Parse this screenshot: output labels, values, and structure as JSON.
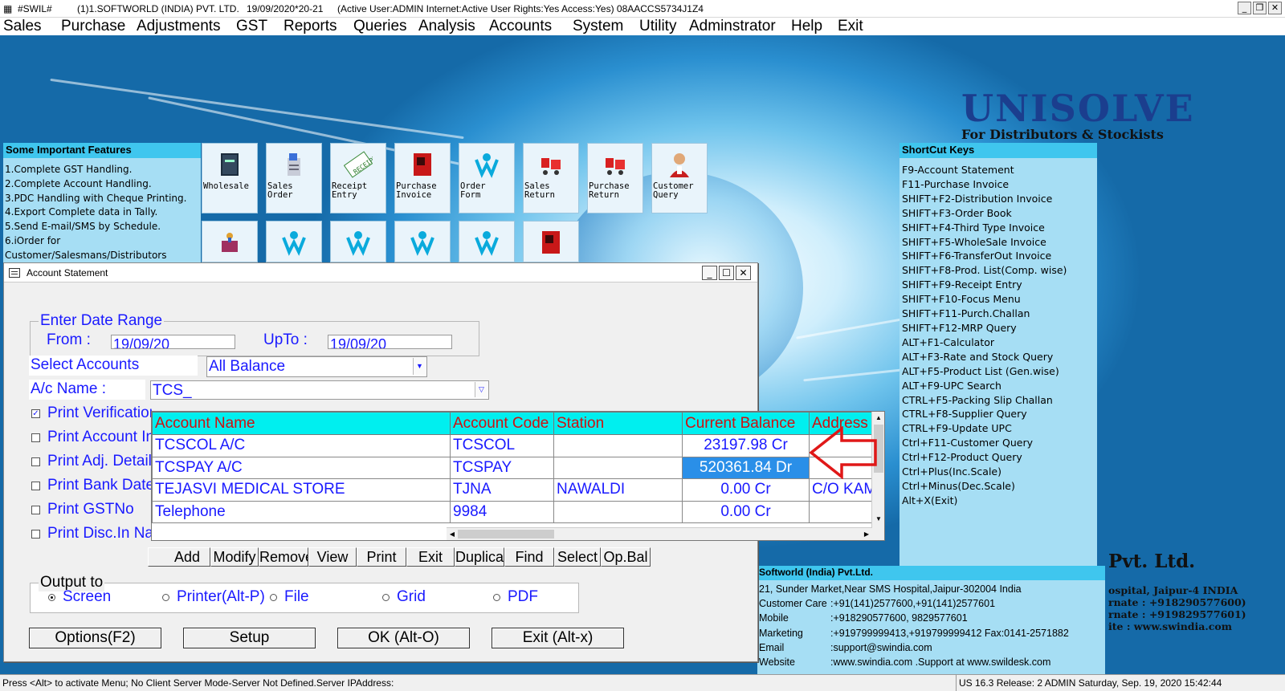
{
  "titlebar": {
    "app": "#SWIL#",
    "company": "(1)1.SOFTWORLD (INDIA) PVT. LTD.",
    "date": "19/09/2020*20-21",
    "status": "(Active User:ADMIN Internet:Active  User Rights:Yes Access:Yes) 08AACCS5734J1Z4"
  },
  "menu": [
    "Sales",
    "Purchase",
    "Adjustments",
    "GST",
    "Reports",
    "Queries",
    "Analysis",
    "Accounts",
    "System",
    "Utility",
    "Adminstrator",
    "Help",
    "Exit"
  ],
  "logo": {
    "title": "UNISOLVE",
    "subtitle": "For Distributors & Stockists"
  },
  "features": {
    "title": "Some Important Features",
    "items": [
      "1.Complete GST Handling.",
      "2.Complete Account Handling.",
      "3.PDC Handling with Cheque Printing.",
      "4.Export Complete data in Tally.",
      "5.Send E-mail/SMS by Schedule.",
      "6.iOrder for",
      "Customer/Salesmans/Distributors"
    ]
  },
  "quick_icons": [
    {
      "label": "Wholesale",
      "icon": "book-icon"
    },
    {
      "label": "Sales\nOrder",
      "icon": "order-icon"
    },
    {
      "label": "Receipt\nEntry",
      "icon": "receipt-stamp-icon"
    },
    {
      "label": "Purchase\nInvoice",
      "icon": "red-book-icon"
    },
    {
      "label": "Order\nForm",
      "icon": "swil-logo-icon"
    },
    {
      "label": "Sales\nReturn",
      "icon": "cart-icon"
    },
    {
      "label": "Purchase\nReturn",
      "icon": "cart-icon"
    },
    {
      "label": "Customer\nQuery",
      "icon": "person-icon"
    }
  ],
  "quick_icons_row2": [
    "register-icon",
    "swil-logo-icon",
    "swil-logo-icon",
    "swil-logo-icon",
    "swil-logo-icon",
    "red-book-icon"
  ],
  "shortcuts": {
    "title": "ShortCut Keys",
    "items": [
      "F9-Account Statement",
      "F11-Purchase Invoice",
      "SHIFT+F2-Distribution Invoice",
      "SHIFT+F3-Order Book",
      "SHIFT+F4-Third Type Invoice",
      "SHIFT+F5-WholeSale Invoice",
      "SHIFT+F6-TransferOut Invoice",
      "SHIFT+F8-Prod. List(Comp. wise)",
      "SHIFT+F9-Receipt Entry",
      "SHIFT+F10-Focus Menu",
      "SHIFT+F11-Purch.Challan",
      "SHIFT+F12-MRP Query",
      "ALT+F1-Calculator",
      "ALT+F3-Rate and Stock Query",
      "ALT+F5-Product List (Gen.wise)",
      "ALT+F9-UPC Search",
      "CTRL+F5-Packing Slip Challan",
      "CTRL+F8-Supplier Query",
      "CTRL+F9-Update UPC",
      "Ctrl+F11-Customer Query",
      "Ctrl+F12-Product Query",
      "Ctrl+Plus(Inc.Scale)",
      "Ctrl+Minus(Dec.Scale)",
      "Alt+X(Exit)"
    ]
  },
  "company": {
    "name": "Softworld (India) Pvt.Ltd.",
    "address": "21, Sunder Market,Near SMS Hospital,Jaipur-302004 India",
    "rows": [
      {
        "k": "Customer Care",
        "v": ":+91(141)2577600,+91(141)2577601"
      },
      {
        "k": "Mobile",
        "v": ":+918290577600, 9829577601"
      },
      {
        "k": "Marketing",
        "v": ":+919799999413,+919799999412 Fax:0141-2571882"
      },
      {
        "k": "Email",
        "v": ":support@swindia.com"
      },
      {
        "k": "Website",
        "v": ":www.swindia.com .Support at www.swildesk.com"
      }
    ],
    "pvt": "Pvt. Ltd.",
    "right_lines": [
      "ospital, Jaipur-4 INDIA",
      "rnate : +918290577600)",
      "rnate : +919829577601)",
      "ite : www.swindia.com"
    ]
  },
  "dialog": {
    "title": "Account Statement",
    "date_range_label": "Enter Date Range",
    "from_label": "From :",
    "from_value": "19/09/20",
    "upto_label": "UpTo :",
    "upto_value": "19/09/20",
    "select_accounts_label": "Select Accounts",
    "select_accounts_value": "All Balance",
    "ac_name_label": "A/c Name :",
    "ac_name_value": "TCS_",
    "checkboxes": [
      {
        "label": "Print Verification",
        "checked": true
      },
      {
        "label": "Print Account In",
        "checked": false
      },
      {
        "label": "Print Adj. Detail",
        "checked": false
      },
      {
        "label": "Print Bank Date",
        "checked": false
      },
      {
        "label": "Print GSTNo",
        "checked": false
      },
      {
        "label": "Print Disc.In Na",
        "checked": false
      }
    ],
    "grid": {
      "columns": [
        "Account Name",
        "Account Code",
        "Station",
        "Current Balance",
        "Address"
      ],
      "rows": [
        [
          "TCSCOL A/C",
          "TCSCOL",
          "",
          "23197.98 Cr",
          ""
        ],
        [
          "TCSPAY A/C",
          "TCSPAY",
          "",
          "520361.84 Dr",
          ""
        ],
        [
          "TEJASVI MEDICAL STORE",
          "TJNA",
          "NAWALDI",
          "0.00 Cr",
          "C/O KAM"
        ],
        [
          "Telephone",
          "9984",
          "",
          "0.00 Cr",
          ""
        ]
      ]
    },
    "grid_buttons": [
      "Add",
      "Modify",
      "Remove",
      "View",
      "Print",
      "Exit",
      "Duplicate",
      "Find",
      "Select",
      "Op.Bal"
    ],
    "output_label": "Output to",
    "output_options": [
      {
        "label": "Screen",
        "selected": true
      },
      {
        "label": "Printer(Alt-P)",
        "selected": false
      },
      {
        "label": "File",
        "selected": false
      },
      {
        "label": "Grid",
        "selected": false
      },
      {
        "label": "PDF",
        "selected": false
      }
    ],
    "buttons": {
      "options": "Options(F2)",
      "setup": "Setup",
      "ok": "OK (Alt-O)",
      "exit": "Exit (Alt-x)"
    }
  },
  "statusbar": {
    "left": "Press <Alt> to activate Menu; No Client Server Mode-Server Not Defined.Server IPAddress:",
    "right": "US 16.3 Release: 2  ADMIN  Saturday, Sep. 19, 2020   15:42:44"
  },
  "colors": {
    "header": "#3fc6ee",
    "panel": "#a6def4",
    "grid_header": "#00efef",
    "grid_header_text": "#d01010",
    "selection": "#2a8fe8",
    "label": "#1a1aff",
    "arrow": "#e01818"
  }
}
